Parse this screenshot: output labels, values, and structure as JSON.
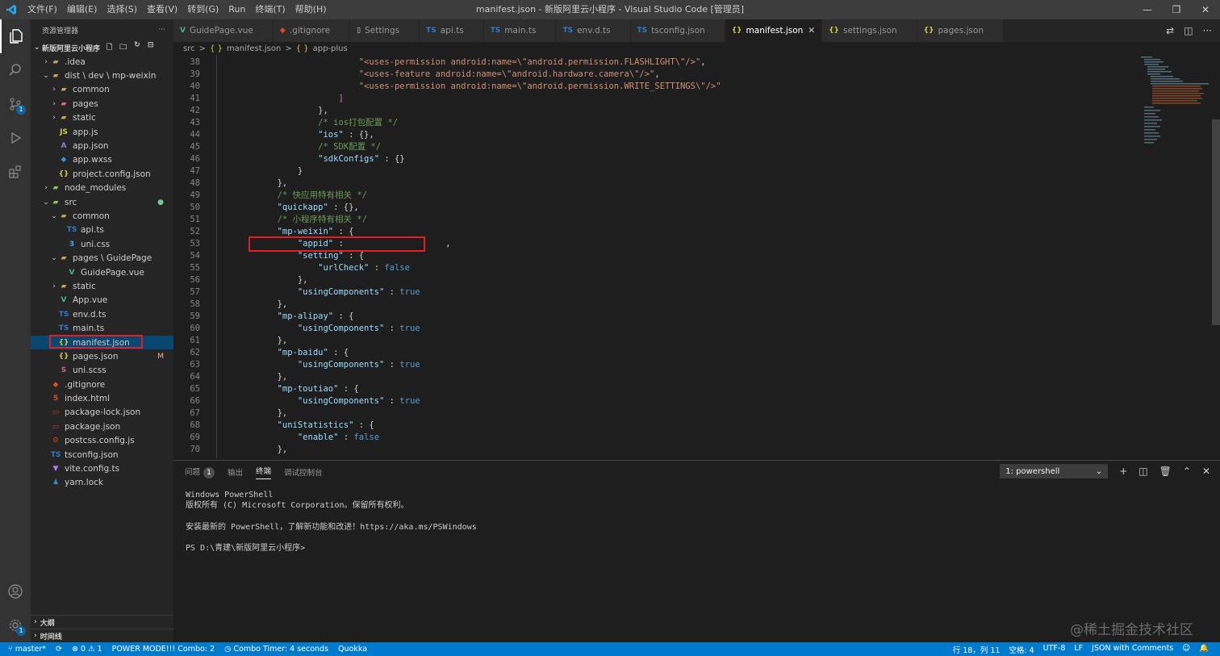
{
  "titlebar": {
    "menu": [
      "文件(F)",
      "编辑(E)",
      "选择(S)",
      "查看(V)",
      "转到(G)",
      "Run",
      "终端(T)",
      "帮助(H)"
    ],
    "title": "manifest.json - 新版阿里云小程序 - Visual Studio Code [管理员]",
    "min": "—",
    "max": "❐",
    "close": "✕"
  },
  "activity": {
    "scm_badge": "1",
    "settings_badge": "1"
  },
  "explorer": {
    "header": "资源管理器",
    "more": "···",
    "project": "新版阿里云小程序",
    "rows": [
      {
        "label": ".idea",
        "indent": 1,
        "chev": "›",
        "icon": "▰",
        "color": "#c5a25a"
      },
      {
        "label": "dist \\ dev \\ mp-weixin",
        "indent": 1,
        "chev": "⌄",
        "icon": "▰",
        "color": "#c5a25a"
      },
      {
        "label": "common",
        "indent": 2,
        "chev": "›",
        "icon": "▰",
        "color": "#c5a25a"
      },
      {
        "label": "pages",
        "indent": 2,
        "chev": "›",
        "icon": "▰",
        "color": "#e06c75"
      },
      {
        "label": "static",
        "indent": 2,
        "chev": "›",
        "icon": "▰",
        "color": "#c5a25a"
      },
      {
        "label": "app.js",
        "indent": 2,
        "chev": "",
        "icon": "JS",
        "color": "#cbcb41"
      },
      {
        "label": "app.json",
        "indent": 2,
        "chev": "",
        "icon": "A",
        "color": "#8a7ce0"
      },
      {
        "label": "app.wxss",
        "indent": 2,
        "chev": "",
        "icon": "◆",
        "color": "#3d8fd1"
      },
      {
        "label": "project.config.json",
        "indent": 2,
        "chev": "",
        "icon": "{}",
        "color": "#cbcb41"
      },
      {
        "label": "node_modules",
        "indent": 1,
        "chev": "›",
        "icon": "▰",
        "color": "#8bc34a"
      },
      {
        "label": "src",
        "indent": 1,
        "chev": "⌄",
        "icon": "▰",
        "color": "#8bc34a",
        "status": "●"
      },
      {
        "label": "common",
        "indent": 2,
        "chev": "⌄",
        "icon": "▰",
        "color": "#c5a25a"
      },
      {
        "label": "api.ts",
        "indent": 3,
        "chev": "",
        "icon": "TS",
        "color": "#3178c6"
      },
      {
        "label": "uni.css",
        "indent": 3,
        "chev": "",
        "icon": "3",
        "color": "#42a5f5"
      },
      {
        "label": "pages \\ GuidePage",
        "indent": 2,
        "chev": "⌄",
        "icon": "▰",
        "color": "#c5a25a"
      },
      {
        "label": "GuidePage.vue",
        "indent": 3,
        "chev": "",
        "icon": "V",
        "color": "#41b883"
      },
      {
        "label": "static",
        "indent": 2,
        "chev": "›",
        "icon": "▰",
        "color": "#c5a25a"
      },
      {
        "label": "App.vue",
        "indent": 2,
        "chev": "",
        "icon": "V",
        "color": "#41b883"
      },
      {
        "label": "env.d.ts",
        "indent": 2,
        "chev": "",
        "icon": "TS",
        "color": "#3178c6"
      },
      {
        "label": "main.ts",
        "indent": 2,
        "chev": "",
        "icon": "TS",
        "color": "#3178c6"
      },
      {
        "label": "manifest.json",
        "indent": 2,
        "chev": "",
        "icon": "{}",
        "color": "#cbcb41",
        "selected": true
      },
      {
        "label": "pages.json",
        "indent": 2,
        "chev": "",
        "icon": "{}",
        "color": "#cbcb41",
        "status": "M"
      },
      {
        "label": "uni.scss",
        "indent": 2,
        "chev": "",
        "icon": "S",
        "color": "#cd6799"
      },
      {
        "label": ".gitignore",
        "indent": 1,
        "chev": "",
        "icon": "◆",
        "color": "#e64a19"
      },
      {
        "label": "index.html",
        "indent": 1,
        "chev": "",
        "icon": "5",
        "color": "#e44d26"
      },
      {
        "label": "package-lock.json",
        "indent": 1,
        "chev": "",
        "icon": "▭",
        "color": "#cb3837"
      },
      {
        "label": "package.json",
        "indent": 1,
        "chev": "",
        "icon": "▭",
        "color": "#cb3837"
      },
      {
        "label": "postcss.config.js",
        "indent": 1,
        "chev": "",
        "icon": "⚙",
        "color": "#dd3a0a"
      },
      {
        "label": "tsconfig.json",
        "indent": 1,
        "chev": "",
        "icon": "TS",
        "color": "#3178c6"
      },
      {
        "label": "vite.config.ts",
        "indent": 1,
        "chev": "",
        "icon": "▼",
        "color": "#a97bff"
      },
      {
        "label": "yarn.lock",
        "indent": 1,
        "chev": "",
        "icon": "♟",
        "color": "#2c8ebb"
      }
    ],
    "outline": "大纲",
    "timeline": "时间线"
  },
  "tabs": [
    {
      "label": "GuidePage.vue",
      "icon": "V",
      "color": "#41b883"
    },
    {
      "label": ".gitignore",
      "icon": "◆",
      "color": "#e64a19"
    },
    {
      "label": "Settings",
      "icon": "▯",
      "color": "#ccc"
    },
    {
      "label": "api.ts",
      "icon": "TS",
      "color": "#3178c6"
    },
    {
      "label": "main.ts",
      "icon": "TS",
      "color": "#3178c6"
    },
    {
      "label": "env.d.ts",
      "icon": "TS",
      "color": "#3178c6"
    },
    {
      "label": "tsconfig.json",
      "icon": "TS",
      "color": "#3178c6"
    },
    {
      "label": "manifest.json",
      "icon": "{}",
      "color": "#cbcb41",
      "active": true
    },
    {
      "label": "settings.json",
      "icon": "{}",
      "color": "#cbcb41"
    },
    {
      "label": "pages.json",
      "icon": "{}",
      "color": "#cbcb41"
    }
  ],
  "breadcrumb": [
    "src",
    ">",
    "{ }",
    "manifest.json",
    ">",
    "{ }",
    "app-plus"
  ],
  "editor": {
    "lines": [
      {
        "n": 38,
        "tokens": [
          [
            "                        ",
            "p"
          ],
          [
            "\"<uses-permission android:name=\\\"android.permission.FLASHLIGHT\\\"/>\"",
            "str"
          ],
          [
            ",",
            "p"
          ]
        ]
      },
      {
        "n": 39,
        "tokens": [
          [
            "                        ",
            "p"
          ],
          [
            "\"<uses-feature android:name=\\\"android.hardware.camera\\\"/>\"",
            "str"
          ],
          [
            ",",
            "p"
          ]
        ]
      },
      {
        "n": 40,
        "tokens": [
          [
            "                        ",
            "p"
          ],
          [
            "\"<uses-permission android:name=\\\"android.permission.WRITE_SETTINGS\\\"/>\"",
            "str"
          ]
        ]
      },
      {
        "n": 41,
        "tokens": [
          [
            "                    ",
            "p"
          ],
          [
            "]",
            "br"
          ]
        ]
      },
      {
        "n": 42,
        "tokens": [
          [
            "                ",
            "p"
          ],
          [
            "},",
            "p"
          ]
        ]
      },
      {
        "n": 43,
        "tokens": [
          [
            "                ",
            "p"
          ],
          [
            "/* ios打包配置 */",
            "com"
          ]
        ]
      },
      {
        "n": 44,
        "tokens": [
          [
            "                ",
            "p"
          ],
          [
            "\"ios\"",
            "key"
          ],
          [
            " : {},",
            "p"
          ]
        ]
      },
      {
        "n": 45,
        "tokens": [
          [
            "                ",
            "p"
          ],
          [
            "/* SDK配置 */",
            "com"
          ]
        ]
      },
      {
        "n": 46,
        "tokens": [
          [
            "                ",
            "p"
          ],
          [
            "\"sdkConfigs\"",
            "key"
          ],
          [
            " : {}",
            "p"
          ]
        ]
      },
      {
        "n": 47,
        "tokens": [
          [
            "            ",
            "p"
          ],
          [
            "}",
            "p"
          ]
        ]
      },
      {
        "n": 48,
        "tokens": [
          [
            "        ",
            "p"
          ],
          [
            "},",
            "p"
          ]
        ]
      },
      {
        "n": 49,
        "tokens": [
          [
            "        ",
            "p"
          ],
          [
            "/* 快应用特有相关 */",
            "com"
          ]
        ]
      },
      {
        "n": 50,
        "tokens": [
          [
            "        ",
            "p"
          ],
          [
            "\"quickapp\"",
            "key"
          ],
          [
            " : {},",
            "p"
          ]
        ]
      },
      {
        "n": 51,
        "tokens": [
          [
            "        ",
            "p"
          ],
          [
            "/* 小程序特有相关 */",
            "com"
          ]
        ]
      },
      {
        "n": 52,
        "tokens": [
          [
            "        ",
            "p"
          ],
          [
            "\"mp-weixin\"",
            "key"
          ],
          [
            " : {",
            "p"
          ]
        ]
      },
      {
        "n": 53,
        "tokens": [
          [
            "            ",
            "p"
          ],
          [
            "\"appid\"",
            "key"
          ],
          [
            " :                    ,",
            "p"
          ]
        ]
      },
      {
        "n": 54,
        "tokens": [
          [
            "            ",
            "p"
          ],
          [
            "\"setting\"",
            "key"
          ],
          [
            " : {",
            "p"
          ]
        ]
      },
      {
        "n": 55,
        "tokens": [
          [
            "                ",
            "p"
          ],
          [
            "\"urlCheck\"",
            "key"
          ],
          [
            " : ",
            "p"
          ],
          [
            "false",
            "kw"
          ]
        ]
      },
      {
        "n": 56,
        "tokens": [
          [
            "            ",
            "p"
          ],
          [
            "},",
            "p"
          ]
        ]
      },
      {
        "n": 57,
        "tokens": [
          [
            "            ",
            "p"
          ],
          [
            "\"usingComponents\"",
            "key"
          ],
          [
            " : ",
            "p"
          ],
          [
            "true",
            "kw"
          ]
        ]
      },
      {
        "n": 58,
        "tokens": [
          [
            "        ",
            "p"
          ],
          [
            "},",
            "p"
          ]
        ]
      },
      {
        "n": 59,
        "tokens": [
          [
            "        ",
            "p"
          ],
          [
            "\"mp-alipay\"",
            "key"
          ],
          [
            " : {",
            "p"
          ]
        ]
      },
      {
        "n": 60,
        "tokens": [
          [
            "            ",
            "p"
          ],
          [
            "\"usingComponents\"",
            "key"
          ],
          [
            " : ",
            "p"
          ],
          [
            "true",
            "kw"
          ]
        ]
      },
      {
        "n": 61,
        "tokens": [
          [
            "        ",
            "p"
          ],
          [
            "},",
            "p"
          ]
        ]
      },
      {
        "n": 62,
        "tokens": [
          [
            "        ",
            "p"
          ],
          [
            "\"mp-baidu\"",
            "key"
          ],
          [
            " : {",
            "p"
          ]
        ]
      },
      {
        "n": 63,
        "tokens": [
          [
            "            ",
            "p"
          ],
          [
            "\"usingComponents\"",
            "key"
          ],
          [
            " : ",
            "p"
          ],
          [
            "true",
            "kw"
          ]
        ]
      },
      {
        "n": 64,
        "tokens": [
          [
            "        ",
            "p"
          ],
          [
            "},",
            "p"
          ]
        ]
      },
      {
        "n": 65,
        "tokens": [
          [
            "        ",
            "p"
          ],
          [
            "\"mp-toutiao\"",
            "key"
          ],
          [
            " : {",
            "p"
          ]
        ]
      },
      {
        "n": 66,
        "tokens": [
          [
            "            ",
            "p"
          ],
          [
            "\"usingComponents\"",
            "key"
          ],
          [
            " : ",
            "p"
          ],
          [
            "true",
            "kw"
          ]
        ]
      },
      {
        "n": 67,
        "tokens": [
          [
            "        ",
            "p"
          ],
          [
            "},",
            "p"
          ]
        ]
      },
      {
        "n": 68,
        "tokens": [
          [
            "        ",
            "p"
          ],
          [
            "\"uniStatistics\"",
            "key"
          ],
          [
            " : {",
            "p"
          ]
        ]
      },
      {
        "n": 69,
        "tokens": [
          [
            "            ",
            "p"
          ],
          [
            "\"enable\"",
            "key"
          ],
          [
            " : ",
            "p"
          ],
          [
            "false",
            "kw"
          ]
        ]
      },
      {
        "n": 70,
        "tokens": [
          [
            "        ",
            "p"
          ],
          [
            "},",
            "p"
          ]
        ]
      }
    ]
  },
  "panel": {
    "tabs": [
      "问题",
      "输出",
      "终端",
      "调试控制台"
    ],
    "problems_count": "1",
    "terminal_select": "1: powershell",
    "terminal_lines": [
      "Windows PowerShell",
      "版权所有 (C) Microsoft Corporation。保留所有权利。",
      "",
      "安装最新的 PowerShell，了解新功能和改进！https://aka.ms/PSWindows",
      "",
      "PS D:\\青建\\新版阿里云小程序>"
    ]
  },
  "statusbar": {
    "branch": "master*",
    "sync": "⟳",
    "problems": "⊗ 0 ⚠ 1",
    "power": "POWER MODE!!! Combo: 2",
    "timer": "◷ Combo Timer: 4 seconds",
    "quokka": "Quokka",
    "right": [
      "行 18，列 11",
      "空格: 4",
      "UTF-8",
      "LF",
      "JSON with Comments"
    ]
  },
  "watermark": "@稀土掘金技术社区",
  "colors": {
    "accent": "#007acc",
    "highlight": "#e51c23",
    "selection": "#094771"
  }
}
